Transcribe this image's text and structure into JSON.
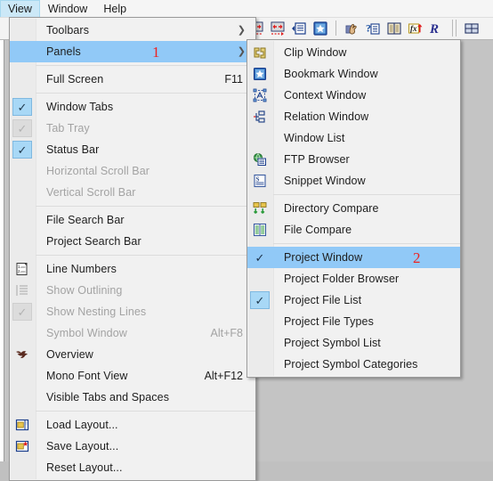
{
  "window": {
    "background_color": "#c3c3c3"
  },
  "menubar": {
    "items": [
      {
        "label": "View",
        "active": true
      },
      {
        "label": "Window",
        "active": false
      },
      {
        "label": "Help",
        "active": false
      }
    ]
  },
  "toolbar": {
    "buttons": [
      {
        "name": "expand-all-icon",
        "title": "Expand All"
      },
      {
        "name": "collapse-all-icon",
        "title": "Collapse All"
      },
      {
        "name": "outline-panel-icon",
        "title": "Outline Panel"
      },
      {
        "name": "bookmark-panel-icon",
        "title": "Bookmark Panel"
      },
      {
        "name": "hand-tool-icon",
        "title": "Hand Tool"
      },
      {
        "name": "help-reference-icon",
        "title": "Context Help"
      },
      {
        "name": "dictionary-icon",
        "title": "Dictionary"
      },
      {
        "name": "function-list-icon",
        "title": "Function List"
      },
      {
        "name": "regex-icon",
        "title": "Regular Expression"
      },
      {
        "name": "tile-windows-icon",
        "title": "Tile Windows"
      }
    ]
  },
  "view_menu": {
    "items": [
      {
        "label": "Toolbars",
        "shortcut": "",
        "icon": "none",
        "check": "none",
        "arrow": true,
        "highlight": false,
        "disabled": false,
        "separator_after": false
      },
      {
        "label": "Panels",
        "shortcut": "",
        "icon": "none",
        "check": "none",
        "arrow": true,
        "highlight": true,
        "disabled": false,
        "separator_after": true,
        "annotation": "1"
      },
      {
        "label": "Full Screen",
        "shortcut": "F11",
        "icon": "none",
        "check": "none",
        "arrow": false,
        "highlight": false,
        "disabled": false,
        "separator_after": true
      },
      {
        "label": "Window Tabs",
        "shortcut": "",
        "icon": "none",
        "check": "checked",
        "arrow": false,
        "highlight": false,
        "disabled": false,
        "separator_after": false
      },
      {
        "label": "Tab Tray",
        "shortcut": "",
        "icon": "none",
        "check": "disabled",
        "arrow": false,
        "highlight": false,
        "disabled": true,
        "separator_after": false
      },
      {
        "label": "Status Bar",
        "shortcut": "",
        "icon": "none",
        "check": "checked",
        "arrow": false,
        "highlight": false,
        "disabled": false,
        "separator_after": false
      },
      {
        "label": "Horizontal Scroll Bar",
        "shortcut": "",
        "icon": "none",
        "check": "none",
        "arrow": false,
        "highlight": false,
        "disabled": true,
        "separator_after": false
      },
      {
        "label": "Vertical Scroll Bar",
        "shortcut": "",
        "icon": "none",
        "check": "none",
        "arrow": false,
        "highlight": false,
        "disabled": true,
        "separator_after": true
      },
      {
        "label": "File Search Bar",
        "shortcut": "",
        "icon": "none",
        "check": "none",
        "arrow": false,
        "highlight": false,
        "disabled": false,
        "separator_after": false
      },
      {
        "label": "Project Search Bar",
        "shortcut": "",
        "icon": "none",
        "check": "none",
        "arrow": false,
        "highlight": false,
        "disabled": false,
        "separator_after": true
      },
      {
        "label": "Line Numbers",
        "shortcut": "",
        "icon": "line-numbers-icon",
        "check": "none",
        "arrow": false,
        "highlight": false,
        "disabled": false,
        "separator_after": false
      },
      {
        "label": "Show Outlining",
        "shortcut": "",
        "icon": "outlining-icon",
        "check": "none",
        "arrow": false,
        "highlight": false,
        "disabled": true,
        "separator_after": false
      },
      {
        "label": "Show Nesting Lines",
        "shortcut": "",
        "icon": "none",
        "check": "disabled",
        "arrow": false,
        "highlight": false,
        "disabled": true,
        "separator_after": false
      },
      {
        "label": "Symbol Window",
        "shortcut": "Alt+F8",
        "icon": "none",
        "check": "none",
        "arrow": false,
        "highlight": false,
        "disabled": true,
        "separator_after": false
      },
      {
        "label": "Overview",
        "shortcut": "",
        "icon": "overview-bird-icon",
        "check": "none",
        "arrow": false,
        "highlight": false,
        "disabled": false,
        "separator_after": false
      },
      {
        "label": "Mono Font View",
        "shortcut": "Alt+F12",
        "icon": "none",
        "check": "none",
        "arrow": false,
        "highlight": false,
        "disabled": false,
        "separator_after": false
      },
      {
        "label": "Visible Tabs and Spaces",
        "shortcut": "",
        "icon": "none",
        "check": "none",
        "arrow": false,
        "highlight": false,
        "disabled": false,
        "separator_after": true
      },
      {
        "label": "Load Layout...",
        "shortcut": "",
        "icon": "load-layout-icon",
        "check": "none",
        "arrow": false,
        "highlight": false,
        "disabled": false,
        "separator_after": false
      },
      {
        "label": "Save Layout...",
        "shortcut": "",
        "icon": "save-layout-icon",
        "check": "none",
        "arrow": false,
        "highlight": false,
        "disabled": false,
        "separator_after": false
      },
      {
        "label": "Reset Layout...",
        "shortcut": "",
        "icon": "none",
        "check": "none",
        "arrow": false,
        "highlight": false,
        "disabled": false,
        "separator_after": false
      }
    ]
  },
  "panels_submenu": {
    "items": [
      {
        "label": "Clip Window",
        "icon": "clip-window-icon",
        "check": "none",
        "highlight": false,
        "separator_after": false
      },
      {
        "label": "Bookmark Window",
        "icon": "bookmark-window-icon",
        "check": "none",
        "highlight": false,
        "separator_after": false
      },
      {
        "label": "Context Window",
        "icon": "context-window-icon",
        "check": "none",
        "highlight": false,
        "separator_after": false
      },
      {
        "label": "Relation Window",
        "icon": "relation-window-icon",
        "check": "none",
        "highlight": false,
        "separator_after": false
      },
      {
        "label": "Window List",
        "icon": "none",
        "check": "none",
        "highlight": false,
        "separator_after": false
      },
      {
        "label": "FTP Browser",
        "icon": "ftp-browser-icon",
        "check": "none",
        "highlight": false,
        "separator_after": false
      },
      {
        "label": "Snippet Window",
        "icon": "snippet-window-icon",
        "check": "none",
        "highlight": false,
        "separator_after": true
      },
      {
        "label": "Directory Compare",
        "icon": "directory-compare-icon",
        "check": "none",
        "highlight": false,
        "separator_after": false
      },
      {
        "label": "File Compare",
        "icon": "file-compare-icon",
        "check": "none",
        "highlight": false,
        "separator_after": true
      },
      {
        "label": "Project Window",
        "icon": "none",
        "check": "checked-highlight",
        "highlight": true,
        "separator_after": false,
        "annotation": "2"
      },
      {
        "label": "Project Folder Browser",
        "icon": "none",
        "check": "none",
        "highlight": false,
        "separator_after": false
      },
      {
        "label": "Project File List",
        "icon": "none",
        "check": "checked",
        "highlight": false,
        "separator_after": false
      },
      {
        "label": "Project File Types",
        "icon": "none",
        "check": "none",
        "highlight": false,
        "separator_after": false
      },
      {
        "label": "Project Symbol List",
        "icon": "none",
        "check": "none",
        "highlight": false,
        "separator_after": false
      },
      {
        "label": "Project Symbol Categories",
        "icon": "none",
        "check": "none",
        "highlight": false,
        "separator_after": false
      }
    ]
  },
  "colors": {
    "highlight": "#91c9f7",
    "menu_background": "#f1f1f1",
    "gutter": "#ebebeb",
    "annotation_red": "#ee2222",
    "menubar_active": "#cce8f7"
  }
}
